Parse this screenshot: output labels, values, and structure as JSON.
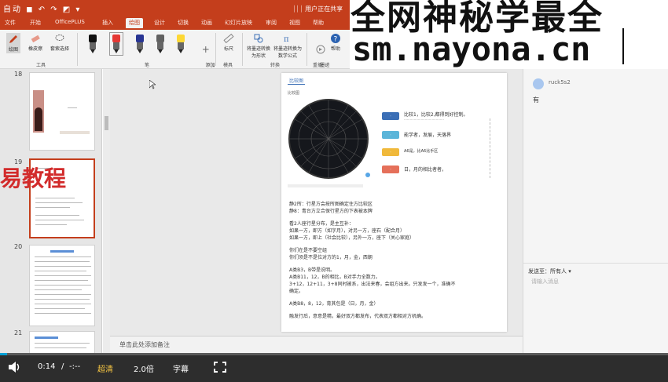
{
  "titlebar": {
    "quick_access": "自动 ◼ ↶ ↷ ◩ ▾",
    "share_label": "⏐⏐⏐ 用户正在共享"
  },
  "ribbon_tabs": [
    {
      "label": "文件"
    },
    {
      "label": "开始"
    },
    {
      "label": "OfficePLUS"
    },
    {
      "label": "插入"
    },
    {
      "label": "绘图"
    },
    {
      "label": "设计"
    },
    {
      "label": "切换"
    },
    {
      "label": "动画"
    },
    {
      "label": "幻灯片放映"
    },
    {
      "label": "审阅"
    },
    {
      "label": "视图"
    },
    {
      "label": "帮助"
    }
  ],
  "ribbon": {
    "tool_draw": "绘图",
    "tool_eraser": "橡皮擦",
    "tool_lasso": "套索选择",
    "group_tools": "工具",
    "add_pen": "添加\n笔",
    "group_pens": "笔",
    "ruler": "标尺",
    "group_stencils": "模具",
    "ink_to_shape": "将墨迹转换为形状",
    "ink_to_math": "将墨迹转换为数学公式",
    "group_convert": "转换",
    "ink_replay": "墨迹\n重播",
    "help": "帮助",
    "group_replay": "重播"
  },
  "colors": {
    "accent": "#c43e1c",
    "pen_black": "#111111",
    "pen_red": "#e53935",
    "pen_navy": "#283593",
    "pen_gray": "#616161",
    "pen_yellow": "#fdd835"
  },
  "watermark": {
    "line1": "全网神秘学最全",
    "line2": "sm.nayona.cn"
  },
  "overlay_text": "易教程",
  "thumbnails": [
    {
      "num": "18"
    },
    {
      "num": "19"
    },
    {
      "num": "20"
    },
    {
      "num": "21"
    }
  ],
  "slide": {
    "header_tab": "比较图",
    "subtitle": "比较图",
    "bullets": [
      "比较1，比较2,都得到好控制。",
      "能学者，发展，天落界",
      "A6是，比A6比手区",
      "日，月的相比者者，"
    ],
    "body": [
      "静2所：行星方会按所图确定住方比较区",
      "静8：青台方立合保行星方的下表被本牌",
      "",
      "看2人座行星分布，是主互补：",
      "如果一方，即方（如字月），对另一方，座石（配合月）",
      "如果一方，即上（社会比较），另外一方，座下（关心家庭）",
      "",
      "你们在是不要空组",
      "你们须是不是位对方的1，月，金，西朝",
      "",
      "A类B3，B带是说明。",
      "A类B11，12，B的相比，B对手力全数力。",
      "3+12，12+11，3+8同时被系，出法来春，会组方出来。只发发一个，准确不",
      "确定。",
      "",
      "A类B8，8，12，育其包是（日，月，金）",
      "",
      "融发行后，意意是精，最好双方都发布，代表双方都相对方机确。"
    ]
  },
  "notes_placeholder": "单击此处添加备注",
  "chat": {
    "username": "ruck5s2",
    "message": "有",
    "recipient_label": "发送至：所有人 ▾",
    "input_placeholder": "请输入消息"
  },
  "player": {
    "time_current": "0:14",
    "time_total": "-:--",
    "quality": "超清",
    "speed": "2.0倍",
    "subtitle": "字幕",
    "progress": 0.01
  }
}
